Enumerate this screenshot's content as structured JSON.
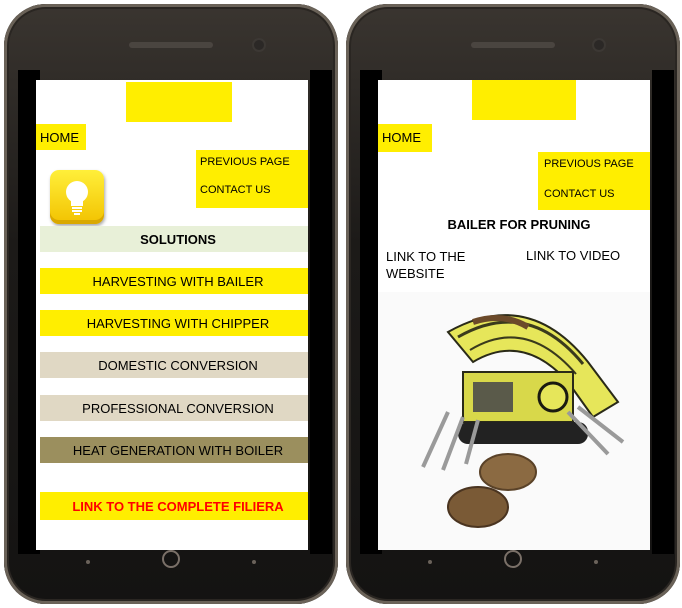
{
  "left_screen": {
    "home": "HOME",
    "previous_page": "PREVIOUS PAGE",
    "contact_us": "CONTACT US",
    "solutions": "SOLUTIONS",
    "menu": [
      {
        "label": "HARVESTING  WITH BAILER",
        "bg": "#ffee00"
      },
      {
        "label": "HARVESTING  WITH CHIPPER",
        "bg": "#ffee00"
      },
      {
        "label": "DOMESTIC CONVERSION",
        "bg": "#e0d8c4"
      },
      {
        "label": "PROFESSIONAL  CONVERSION",
        "bg": "#e0d8c4"
      },
      {
        "label": "HEAT  GENERATION  WITH BOILER",
        "bg": "#9b8f5e"
      }
    ],
    "link_complete": "LINK TO THE COMPLETE FILIERA",
    "icon": "lightbulb-icon"
  },
  "right_screen": {
    "home": "HOME",
    "previous_page": "PREVIOUS PAGE",
    "contact_us": "CONTACT US",
    "title": "BAILER FOR PRUNING",
    "link_website": "LINK TO THE WEBSITE",
    "link_video": "LINK TO VIDEO",
    "image": "bailer-machine-image"
  },
  "colors": {
    "yellow": "#ffee00",
    "solutions_bg": "#e8f0d8",
    "beige": "#e0d8c4",
    "olive": "#9b8f5e",
    "link_red": "#ff0000"
  }
}
